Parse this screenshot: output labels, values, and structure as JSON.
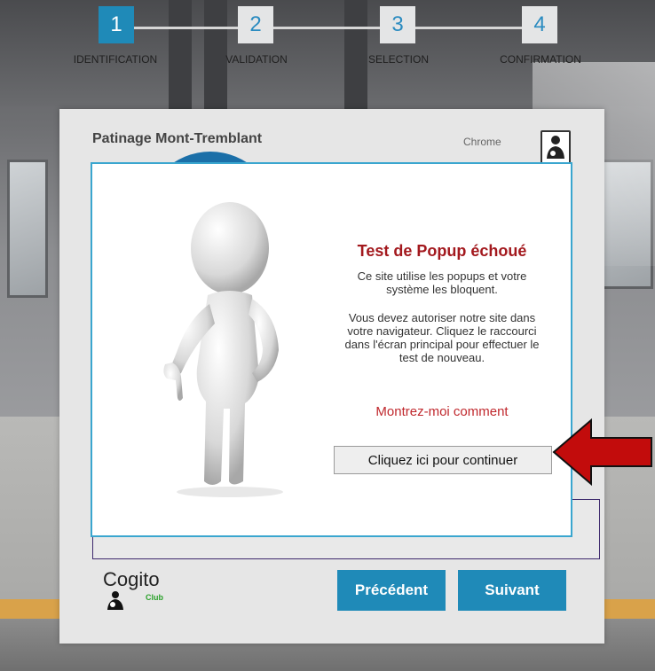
{
  "stepper": {
    "steps": [
      {
        "number": "1",
        "label": "IDENTIFICATION"
      },
      {
        "number": "2",
        "label": "VALIDATION"
      },
      {
        "number": "3",
        "label": "SELECTION"
      },
      {
        "number": "4",
        "label": "CONFIRMATION"
      }
    ],
    "active_step": 1
  },
  "card": {
    "club_name": "Patinage Mont-Tremblant",
    "browser": "Chrome",
    "logo_text": "Cogito",
    "logo_sub": "Club",
    "prev_label": "Précédent",
    "next_label": "Suivant"
  },
  "popup": {
    "title": "Test de Popup échoué",
    "text1": "Ce site utilise les popups et votre système les bloquent.",
    "text2": "Vous devez autoriser notre site dans votre navigateur. Cliquez le raccourci dans l'écran principal pour effectuer le test de nouveau.",
    "link": "Montrez-moi comment",
    "button": "Cliquez ici pour continuer"
  },
  "colors": {
    "accent": "#1f8ab8",
    "title_red": "#a3191e",
    "link_red": "#c0282d",
    "arrow_red": "#c20c0c"
  },
  "icons": [
    "user-thumbs-down-figure",
    "person-icon",
    "red-arrow-left",
    "cogito-logo"
  ]
}
